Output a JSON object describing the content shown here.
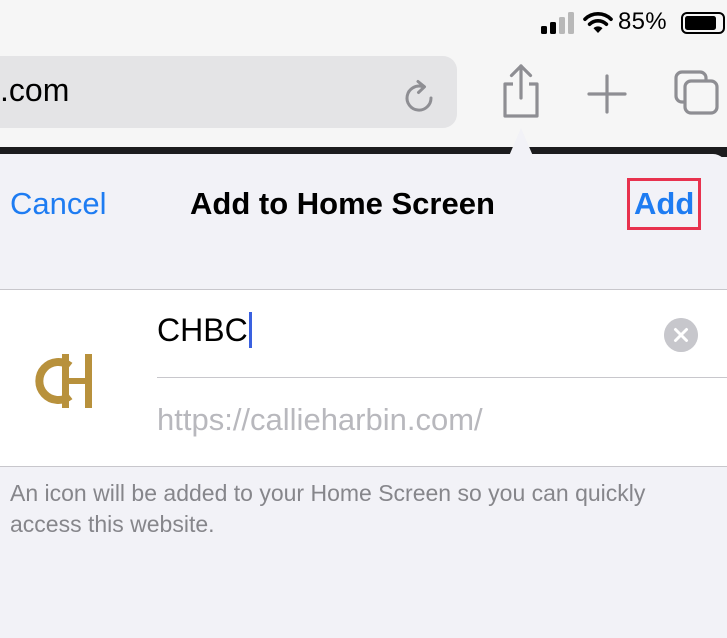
{
  "status_bar": {
    "battery_percent": "85%",
    "battery_level": 0.85,
    "icons": [
      "cellular-signal-icon",
      "wifi-icon",
      "battery-icon"
    ]
  },
  "toolbar": {
    "url_text": ".com",
    "icons": [
      "reload-icon",
      "share-icon",
      "plus-icon",
      "tabs-icon"
    ]
  },
  "sheet": {
    "cancel_label": "Cancel",
    "title": "Add to Home Screen",
    "add_label": "Add",
    "name_value": "CHBC",
    "url": "https://callieharbin.com/",
    "description": "An icon will be added to your Home Screen so you can quickly access this website."
  },
  "colors": {
    "accent": "#1e7cf2",
    "highlight_box": "#e8324e",
    "logo_gold": "#b8913c",
    "caret": "#3a61e0"
  }
}
